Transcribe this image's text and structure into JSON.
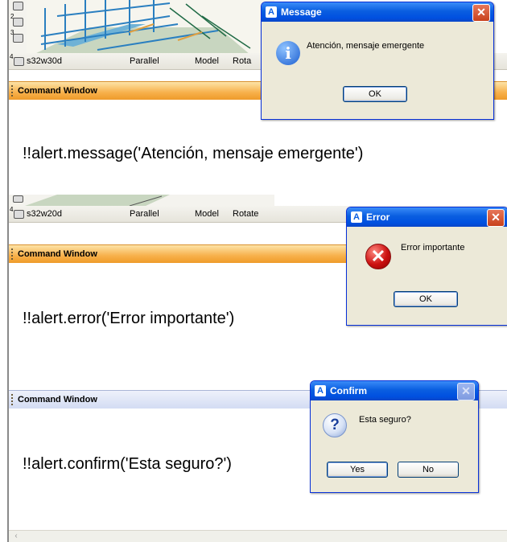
{
  "panel1": {
    "viewport_numbers": [
      "2",
      "3",
      "4"
    ],
    "status": {
      "view": "s32w30d",
      "projection": "Parallel",
      "mode": "Model",
      "action": "Rota"
    },
    "command_window_title": "Command Window",
    "command_text": "!!alert.message('Atención, mensaje emergente')",
    "dialog": {
      "title": "Message",
      "icon": "info-icon",
      "message": "Atención, mensaje emergente",
      "ok_label": "OK"
    }
  },
  "panel2": {
    "viewport_numbers": [
      "4"
    ],
    "status": {
      "view": "s32w20d",
      "projection": "Parallel",
      "mode": "Model",
      "action": "Rotate"
    },
    "command_window_title": "Command Window",
    "command_text": "!!alert.error('Error importante')",
    "dialog": {
      "title": "Error",
      "icon": "error-icon",
      "message": "Error importante",
      "ok_label": "OK"
    }
  },
  "panel3": {
    "command_window_title": "Command Window",
    "command_text": "!!alert.confirm('Esta seguro?')",
    "dialog": {
      "title": "Confirm",
      "icon": "question-icon",
      "message": "Esta seguro?",
      "yes_label": "Yes",
      "no_label": "No"
    }
  },
  "colors": {
    "titlebar_blue": "#0a5ee0",
    "orange_header": "#f7b04a",
    "blue_header": "#d3dcf3",
    "dialog_face": "#ece9d8"
  }
}
